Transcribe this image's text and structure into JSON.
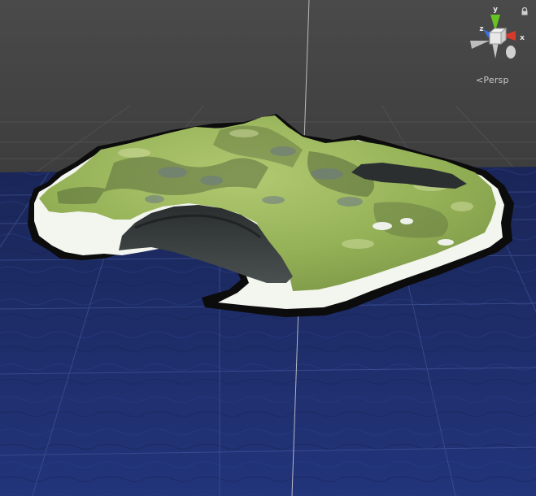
{
  "viewport": {
    "projection_label": "Persp"
  },
  "gizmo": {
    "x_label": "x",
    "y_label": "y",
    "z_label": "z"
  },
  "colors": {
    "background": "#474747",
    "ocean": "#1d2d66",
    "terrain_green": "#9bb85a",
    "snow": "#f2f4ee",
    "axis_x": "#d63a2c",
    "axis_y": "#67c224",
    "axis_z": "#3b6fd9"
  }
}
